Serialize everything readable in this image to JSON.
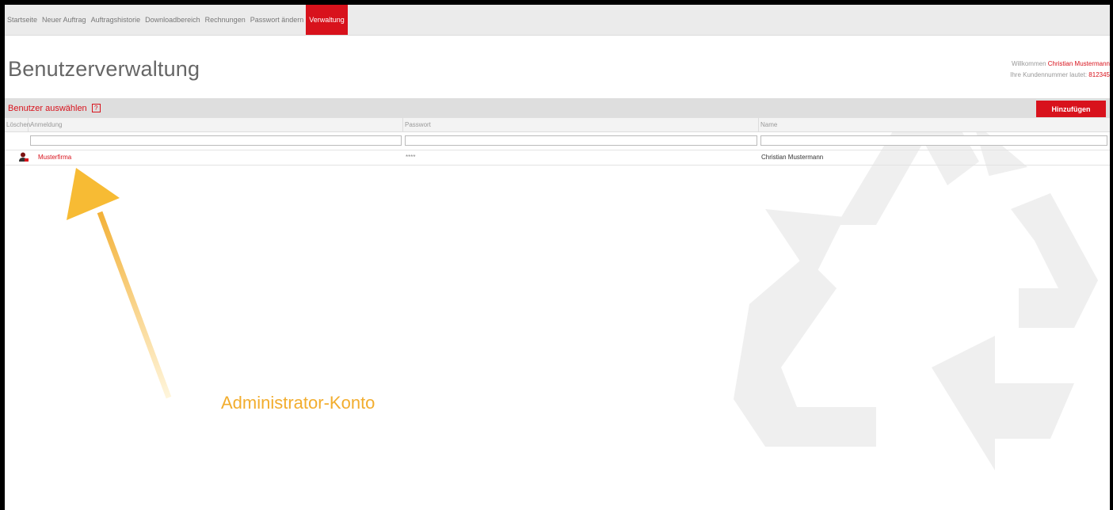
{
  "nav": {
    "items": [
      "Startseite",
      "Neuer Auftrag",
      "Auftragshistorie",
      "Downloadbereich",
      "Rechnungen",
      "Passwort ändern"
    ],
    "active": "Verwaltung"
  },
  "page": {
    "title": "Benutzerverwaltung"
  },
  "welcome": {
    "greeting": "Willkommen",
    "user_name": "Christian Mustermann",
    "customer_label": "Ihre Kundennummer lautet:",
    "customer_number": "812345"
  },
  "section": {
    "title": "Benutzer auswählen",
    "help_icon": "?",
    "add_button": "Hinzufügen"
  },
  "table": {
    "columns": [
      "Löschen",
      "Anmeldung",
      "Passwort",
      "Name"
    ],
    "rows": [
      {
        "icon": "user-icon",
        "login": "Musterfirma",
        "password": "****",
        "name": "Christian Mustermann"
      }
    ]
  },
  "annotation": {
    "text": "Administrator-Konto"
  },
  "colors": {
    "accent": "#d8121c",
    "annotation": "#f2ad2e"
  }
}
